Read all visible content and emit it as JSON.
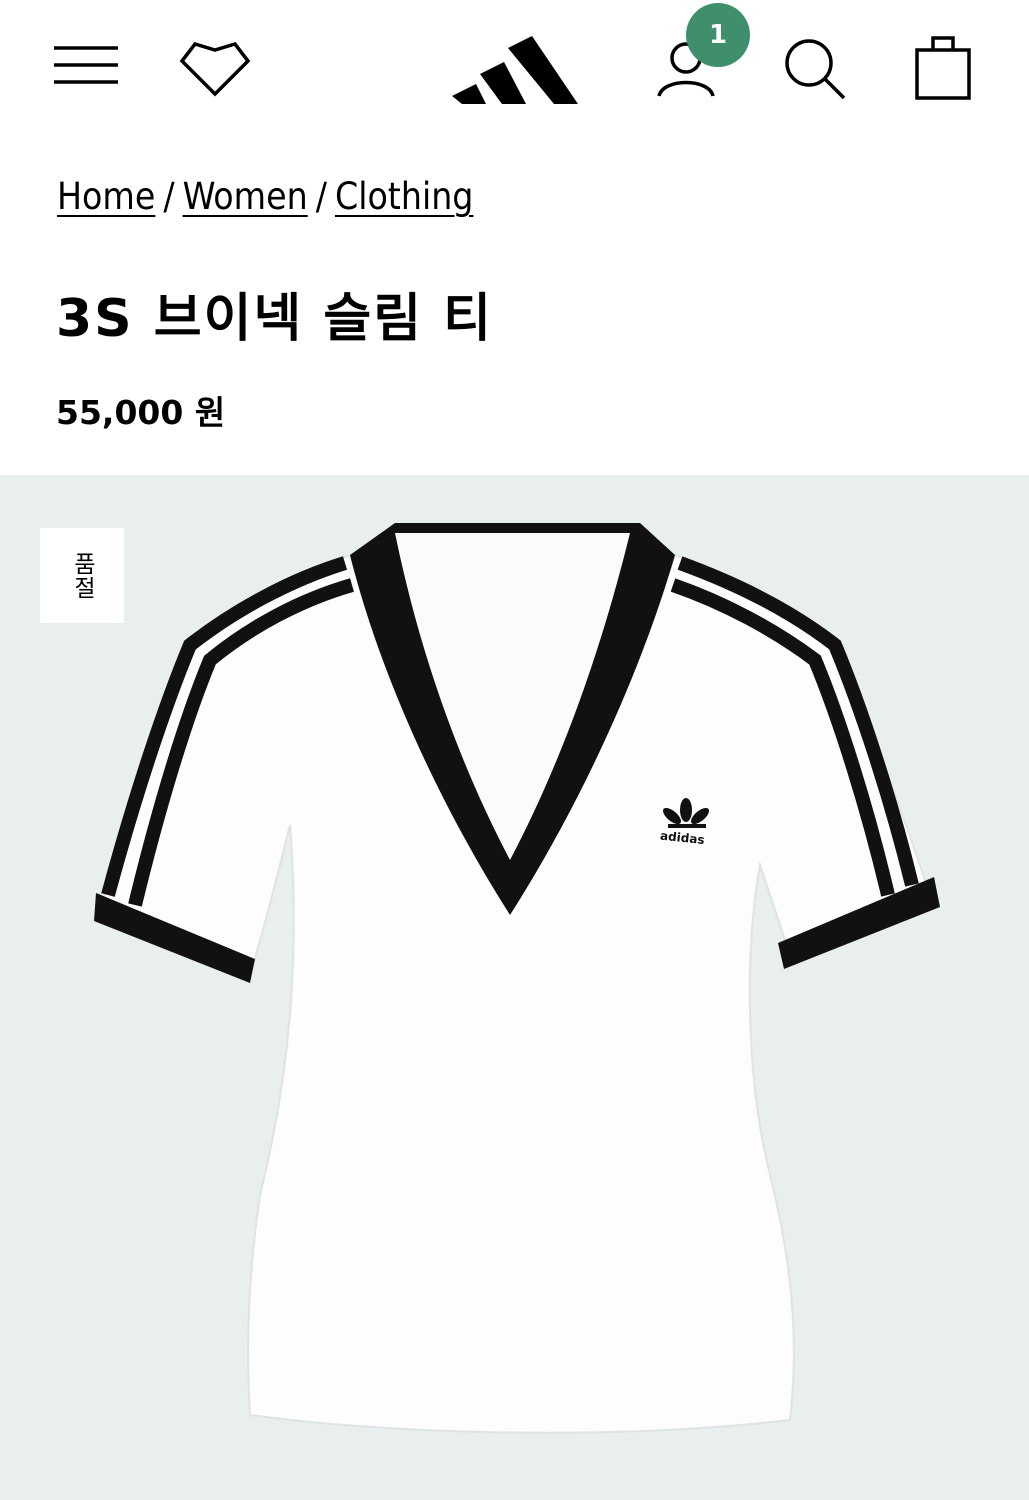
{
  "header": {
    "icons": {
      "menu": "menu-icon",
      "wishlist": "heart-icon",
      "logo": "adidas-logo",
      "account": "user-icon",
      "search": "search-icon",
      "cart": "shopping-bag-icon"
    },
    "account_badge": "1",
    "badge_color": "#3f8f6c"
  },
  "breadcrumb": {
    "items": [
      "Home",
      "Women",
      "Clothing"
    ],
    "separator": "/"
  },
  "product": {
    "title": "3S 브이넥 슬림 티",
    "price": "55,000 원",
    "status_badge": "품절",
    "image_logo_text": "adidas"
  },
  "colors": {
    "gallery_background": "#e9eeef",
    "accent": "#3f8f6c"
  }
}
